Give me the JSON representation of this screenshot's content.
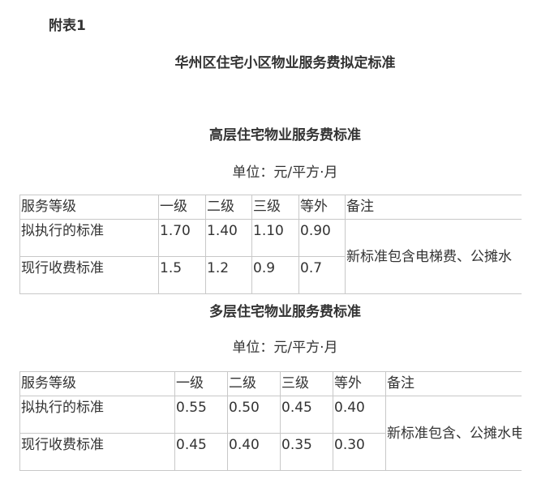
{
  "document": {
    "appendix_label": "附表1",
    "main_title": "华州区住宅小区物业服务费拟定标准"
  },
  "sections": [
    {
      "title": "高层住宅物业服务费标准",
      "unit": "单位：元/平方·月",
      "headers": [
        "服务等级",
        "一级",
        "二级",
        "三级",
        "等外",
        "备注"
      ],
      "rows": [
        {
          "label": "拟执行的标准",
          "values": [
            "1.70",
            "1.40",
            "1.10",
            "0.90"
          ]
        },
        {
          "label": "现行收费标准",
          "values": [
            "1.5",
            "1.2",
            "0.9",
            "0.7"
          ]
        }
      ],
      "note": "新标准包含电梯费、公摊水"
    },
    {
      "title": "多层住宅物业服务费标准",
      "unit": "单位：元/平方·月",
      "headers": [
        "服务等级",
        "一级",
        "二级",
        "三级",
        "等外",
        "备注"
      ],
      "rows": [
        {
          "label": "拟执行的标准",
          "values": [
            "0.55",
            "0.50",
            "0.45",
            "0.40"
          ]
        },
        {
          "label": "现行收费标准",
          "values": [
            "0.45",
            "0.40",
            "0.35",
            "0.30"
          ]
        }
      ],
      "note": "新标准包含、公摊水电"
    }
  ]
}
